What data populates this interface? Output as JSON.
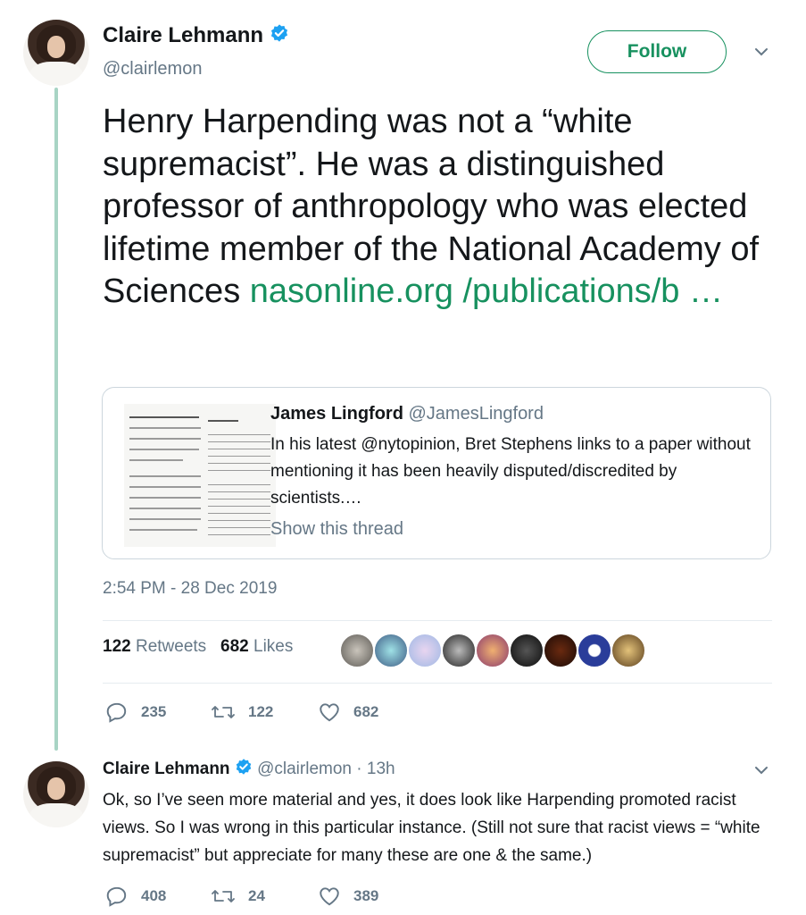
{
  "main_tweet": {
    "author_name": "Claire Lehmann",
    "author_handle": "@clairlemon",
    "follow_label": "Follow",
    "text": "Henry Harpending was not a “white supremacist”. He was a distinguished professor of anthropology who was elected lifetime member of the National Academy of Sciences ",
    "link_text": "nasonline.org /publications/b  …",
    "quoted": {
      "name": "James Lingford",
      "handle": "@JamesLingford",
      "text": "In his latest @nytopinion, Bret Stephens links to a paper without mentioning it has been heavily disputed/discredited by scientists.…",
      "show_thread": "Show this thread"
    },
    "timestamp": "2:54 PM - 28 Dec 2019",
    "retweets_count": "122",
    "retweets_label": "Retweets",
    "likes_count": "682",
    "likes_label": "Likes",
    "actions": {
      "replies": "235",
      "retweets": "122",
      "likes": "682"
    }
  },
  "reply_tweet": {
    "author_name": "Claire Lehmann",
    "author_handle": "@clairlemon",
    "time": "· 13h",
    "text": "Ok, so I’ve seen more material and yes, it does look like Harpending promoted racist views. So I was wrong in this particular instance. (Still not sure that racist views = “white supremacist” but appreciate for many these are one & the same.)",
    "actions": {
      "replies": "408",
      "retweets": "24",
      "likes": "389"
    }
  },
  "icons": [
    "verified-badge-icon",
    "chevron-down-icon",
    "reply-icon",
    "retweet-icon",
    "heart-icon"
  ],
  "colors": {
    "link": "#17915f",
    "verified": "#1da1f2",
    "thread_line": "#a8d4c4",
    "muted": "#657786"
  }
}
